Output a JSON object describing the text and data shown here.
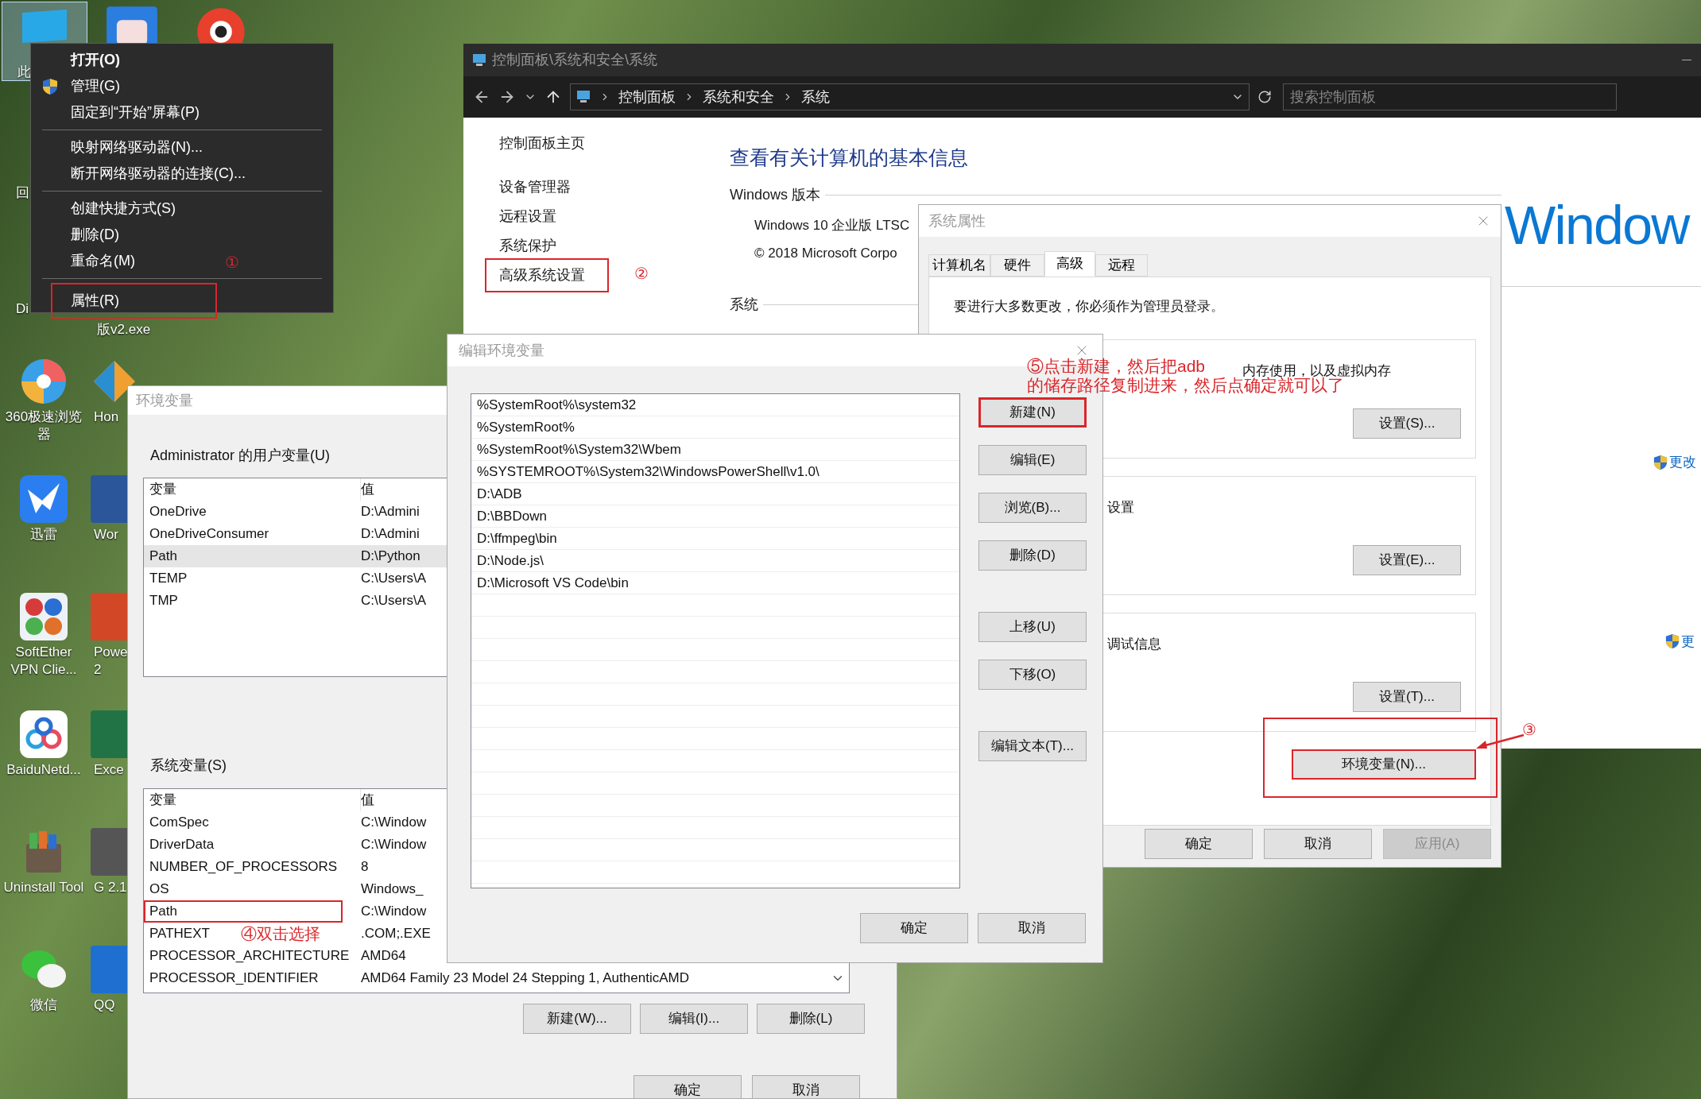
{
  "desktop": {
    "top_labels": [
      "此",
      "回",
      "Di",
      "版v2.exe"
    ],
    "icons": [
      {
        "kind": "pinwheel",
        "label": "360极速浏览器"
      },
      {
        "kind": "bird",
        "label": "迅雷"
      },
      {
        "kind": "dots",
        "label": "SoftEther VPN Clie..."
      },
      {
        "kind": "cloud",
        "label": "BaiduNetd..."
      },
      {
        "kind": "toolbox",
        "label": "Uninstall Tool"
      },
      {
        "kind": "chat",
        "label": "微信"
      }
    ],
    "icons_second_column": [
      {
        "kind": "diamond",
        "label": "Hon"
      },
      {
        "kind": "tile",
        "color": "#2b579a",
        "label": "Wor"
      },
      {
        "kind": "tile",
        "color": "#d24726",
        "label": "Powe 2"
      },
      {
        "kind": "tile",
        "color": "#217346",
        "label": "Exce"
      },
      {
        "kind": "tile",
        "color": "#555555",
        "label": "G 2.1"
      },
      {
        "kind": "tile",
        "color": "#1e6fd0",
        "label": "QQ"
      }
    ]
  },
  "context_menu": {
    "items": [
      {
        "kind": "item",
        "label": "打开(O)",
        "bold": true,
        "shield": false,
        "annotated": false
      },
      {
        "kind": "item",
        "label": "管理(G)",
        "bold": false,
        "shield": true,
        "annotated": false
      },
      {
        "kind": "item",
        "label": "固定到“开始”屏幕(P)",
        "bold": false,
        "shield": false,
        "annotated": false
      },
      {
        "kind": "separator"
      },
      {
        "kind": "item",
        "label": "映射网络驱动器(N)...",
        "bold": false,
        "shield": false,
        "annotated": false
      },
      {
        "kind": "item",
        "label": "断开网络驱动器的连接(C)...",
        "bold": false,
        "shield": false,
        "annotated": false
      },
      {
        "kind": "separator"
      },
      {
        "kind": "item",
        "label": "创建快捷方式(S)",
        "bold": false,
        "shield": false,
        "annotated": false
      },
      {
        "kind": "item",
        "label": "删除(D)",
        "bold": false,
        "shield": false,
        "annotated": false
      },
      {
        "kind": "item",
        "label": "重命名(M)",
        "bold": false,
        "shield": false,
        "annotated": false
      },
      {
        "kind": "separator"
      },
      {
        "kind": "item",
        "label": "属性(R)",
        "bold": false,
        "shield": false,
        "annotated": true
      }
    ],
    "marker": "①"
  },
  "control_panel": {
    "title": "控制面板\\系统和安全\\系统",
    "breadcrumbs": [
      "控制面板",
      "系统和安全",
      "系统"
    ],
    "search": {
      "placeholder": "搜索控制面板"
    },
    "nav": [
      {
        "label": "控制面板主页",
        "annotated": false
      },
      {
        "label": "设备管理器",
        "annotated": false
      },
      {
        "label": "远程设置",
        "annotated": false
      },
      {
        "label": "系统保护",
        "annotated": false
      },
      {
        "label": "高级系统设置",
        "annotated": true
      }
    ],
    "nav_marker": "②",
    "heading": "查看有关计算机的基本信息",
    "edition_section": "Windows 版本",
    "edition": "Windows 10 企业版 LTSC",
    "copyright": "© 2018 Microsoft Corpo",
    "system_section": "系统",
    "logo": "Window",
    "change_links": [
      "更改",
      "更"
    ]
  },
  "system_properties": {
    "title": "系统属性",
    "tabs": [
      {
        "label": "计算机名",
        "selected": false
      },
      {
        "label": "硬件",
        "selected": false
      },
      {
        "label": "高级",
        "selected": true
      },
      {
        "label": "远程",
        "selected": false
      }
    ],
    "notice": "要进行大多数更改，你必须作为管理员登录。",
    "groups": [
      {
        "text": "内存使用，以及虚拟内存",
        "button": "设置(S)..."
      },
      {
        "text": "设置",
        "button": "设置(E)..."
      },
      {
        "text": "调试信息",
        "button": "设置(T)..."
      }
    ],
    "env_button": {
      "label": "环境变量(N)...",
      "annotated": true
    },
    "marker": "③",
    "buttons": [
      {
        "label": "确定",
        "disabled": false
      },
      {
        "label": "取消",
        "disabled": false
      },
      {
        "label": "应用(A)",
        "disabled": true
      }
    ]
  },
  "env_vars": {
    "title": "环境变量",
    "user": {
      "title": "Administrator 的用户变量(U)",
      "columns": [
        "变量",
        "值"
      ],
      "rows": [
        {
          "name": "OneDrive",
          "value": "D:\\Admini",
          "selected": false,
          "annotated": false
        },
        {
          "name": "OneDriveConsumer",
          "value": "D:\\Admini",
          "selected": false,
          "annotated": false
        },
        {
          "name": "Path",
          "value": "D:\\Python",
          "selected": true,
          "annotated": false
        },
        {
          "name": "TEMP",
          "value": "C:\\Users\\A",
          "selected": false,
          "annotated": false
        },
        {
          "name": "TMP",
          "value": "C:\\Users\\A",
          "selected": false,
          "annotated": false
        }
      ]
    },
    "system": {
      "title": "系统变量(S)",
      "columns": [
        "变量",
        "值"
      ],
      "rows": [
        {
          "name": "ComSpec",
          "value": "C:\\Window",
          "selected": false,
          "annotated": false
        },
        {
          "name": "DriverData",
          "value": "C:\\Window",
          "selected": false,
          "annotated": false
        },
        {
          "name": "NUMBER_OF_PROCESSORS",
          "value": "8",
          "selected": false,
          "annotated": false
        },
        {
          "name": "OS",
          "value": "Windows_",
          "selected": false,
          "annotated": false
        },
        {
          "name": "Path",
          "value": "C:\\Window",
          "selected": false,
          "annotated": true
        },
        {
          "name": "PATHEXT",
          "value": ".COM;.EXE",
          "selected": false,
          "annotated": false
        },
        {
          "name": "PROCESSOR_ARCHITECTURE",
          "value": "AMD64",
          "selected": false,
          "annotated": false
        },
        {
          "name": "PROCESSOR_IDENTIFIER",
          "value": "AMD64 Family 23 Model 24 Stepping 1, AuthenticAMD",
          "selected": false,
          "annotated": false
        }
      ]
    },
    "note": "④双击选择",
    "buttons": [
      "新建(W)...",
      "编辑(I)...",
      "删除(L)"
    ],
    "footer": [
      "确定",
      "取消"
    ]
  },
  "edit_dialog": {
    "title": "编辑环境变量",
    "entries": [
      "%SystemRoot%\\system32",
      "%SystemRoot%",
      "%SystemRoot%\\System32\\Wbem",
      "%SYSTEMROOT%\\System32\\WindowsPowerShell\\v1.0\\",
      "D:\\ADB",
      "D:\\BBDown",
      "D:\\ffmpeg\\bin",
      "D:\\Node.js\\",
      "D:\\Microsoft VS Code\\bin"
    ],
    "buttons": [
      {
        "label": "新建(N)",
        "annotated": true
      },
      {
        "label": "编辑(E)",
        "annotated": false
      },
      {
        "label": "浏览(B)...",
        "annotated": false
      },
      {
        "label": "删除(D)",
        "annotated": false
      },
      {
        "label": "上移(U)",
        "annotated": false
      },
      {
        "label": "下移(O)",
        "annotated": false
      },
      {
        "label": "编辑文本(T)...",
        "annotated": false
      }
    ],
    "footer": [
      "确定",
      "取消"
    ],
    "annotation": [
      "⑤点击新建，然后把adb",
      "的储存路径复制进来，然后点确定就可以了"
    ]
  }
}
